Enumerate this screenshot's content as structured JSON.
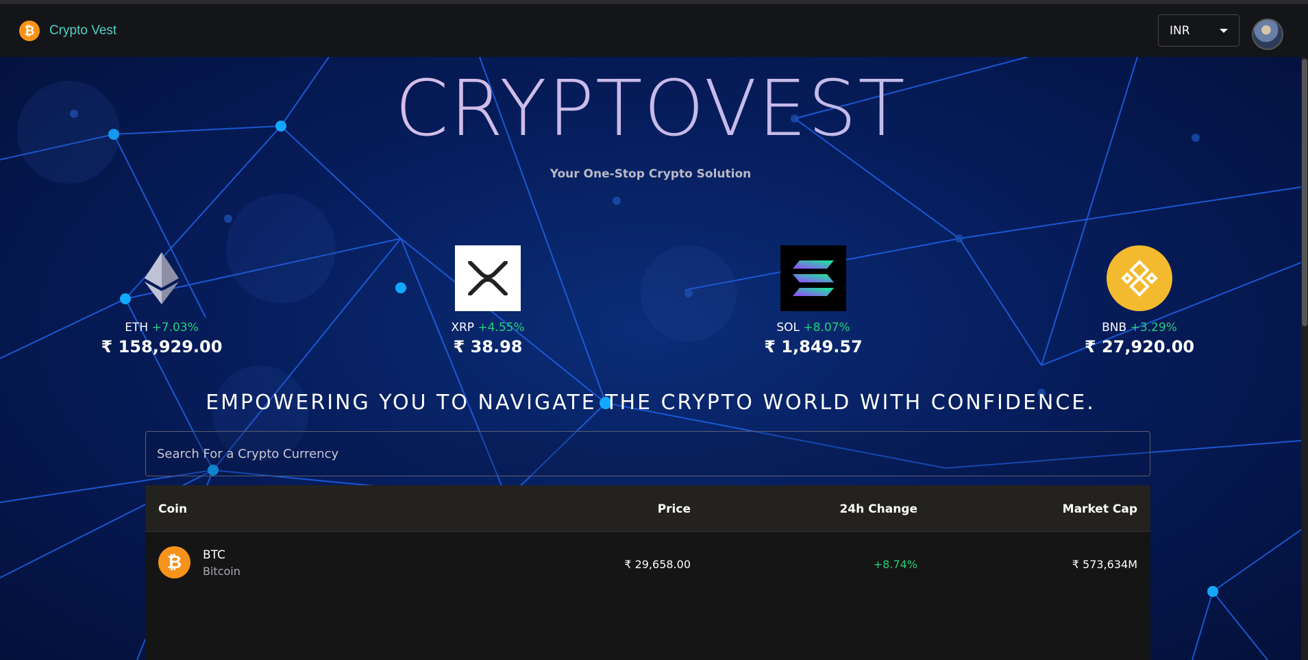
{
  "header": {
    "brand": "Crypto Vest",
    "currency": "INR",
    "logo_icon": "bitcoin-icon",
    "avatar_icon": "user-avatar"
  },
  "hero": {
    "title": "CRYPTOVEST",
    "subtitle": "Your One-Stop Crypto Solution",
    "tagline": "EMPOWERING YOU TO NAVIGATE THE CRYPTO WORLD WITH CONFIDENCE."
  },
  "trending": [
    {
      "symbol": "ETH",
      "change": "+7.03%",
      "price": "₹ 158,929.00",
      "icon": "ethereum-icon"
    },
    {
      "symbol": "XRP",
      "change": "+4.55%",
      "price": "₹ 38.98",
      "icon": "xrp-icon"
    },
    {
      "symbol": "SOL",
      "change": "+8.07%",
      "price": "₹ 1,849.57",
      "icon": "solana-icon"
    },
    {
      "symbol": "BNB",
      "change": "+3.29%",
      "price": "₹ 27,920.00",
      "icon": "bnb-icon"
    }
  ],
  "search": {
    "placeholder": "Search For a Crypto Currency"
  },
  "table": {
    "headers": {
      "coin": "Coin",
      "price": "Price",
      "change": "24h Change",
      "market_cap": "Market Cap"
    },
    "rows": [
      {
        "symbol": "BTC",
        "name": "Bitcoin",
        "price": "₹ 29,658.00",
        "change": "+8.74%",
        "market_cap": "₹ 573,634M",
        "icon": "bitcoin-icon"
      }
    ]
  },
  "colors": {
    "accent": "#4fd1c5",
    "positive": "#22d17a",
    "header_bg": "#141518",
    "bitcoin": "#f7931a",
    "bnb": "#f3ba2f"
  }
}
